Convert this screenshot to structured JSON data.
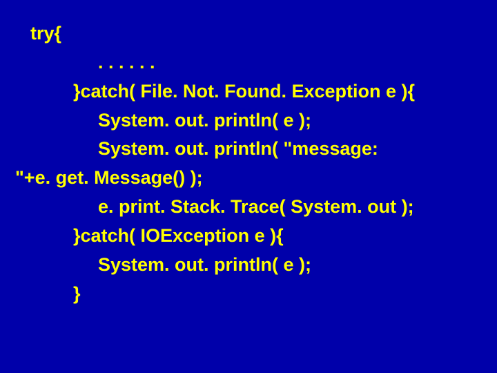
{
  "code": {
    "l1": "try{",
    "l2": ". . . . . .",
    "l3": "}catch( File. Not. Found. Exception e ){",
    "l4": "System. out. println( e );",
    "l5": "System. out. println( \"message:",
    "l6": "\"+e. get. Message() );",
    "l7": "e. print. Stack. Trace( System. out );",
    "l8": "}catch( IOException e ){",
    "l9": "System. out. println( e );",
    "l10": "}"
  }
}
